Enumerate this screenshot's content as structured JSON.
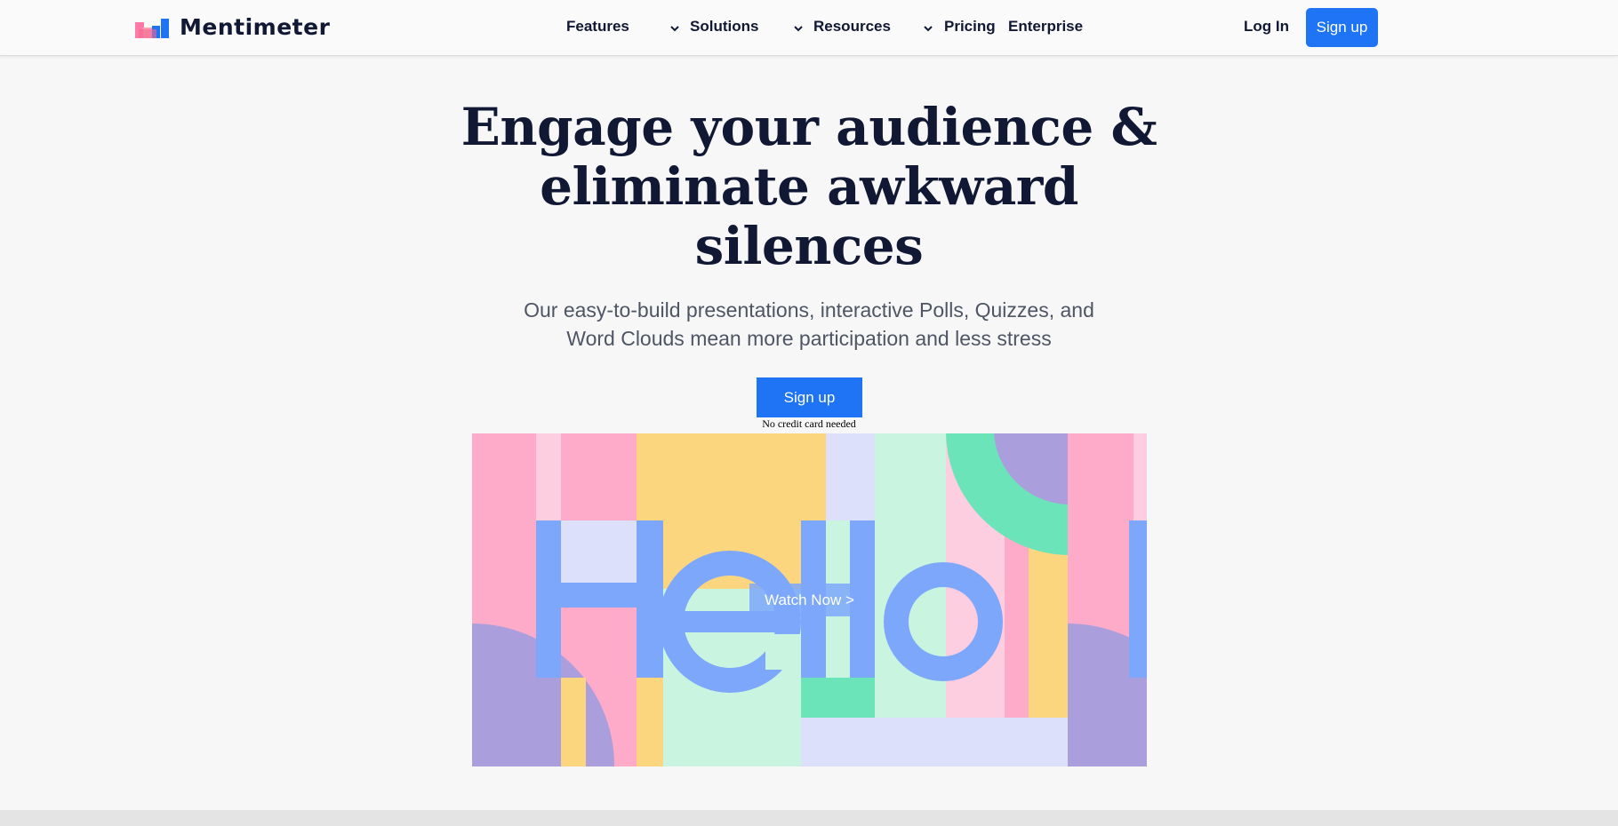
{
  "brand": {
    "name": "Mentimeter",
    "colors": {
      "primary": "#1e74f5",
      "text": "#101834",
      "muted": "#4e5564",
      "background": "#f7f7f7"
    },
    "logo_icon": "mentimeter-bars-icon"
  },
  "nav": {
    "items": [
      {
        "label": "Features",
        "has_dropdown": true
      },
      {
        "label": "Solutions",
        "has_dropdown": true
      },
      {
        "label": "Resources",
        "has_dropdown": true
      },
      {
        "label": "Pricing",
        "has_dropdown": false
      },
      {
        "label": "Enterprise",
        "has_dropdown": false
      }
    ],
    "dropdown_icon": "chevron-down-icon",
    "login_label": "Log In",
    "signup_label": "Sign up"
  },
  "hero": {
    "title": "Engage your audience & eliminate awkward silences",
    "subtitle": "Our easy-to-build presentations, interactive Polls, Quizzes, and Word Clouds mean more participation and less stress",
    "cta_label": "Sign up",
    "cta_note": "No credit card needed"
  },
  "video": {
    "artwork_text": "Hello",
    "watch_label": "Watch Now >"
  }
}
